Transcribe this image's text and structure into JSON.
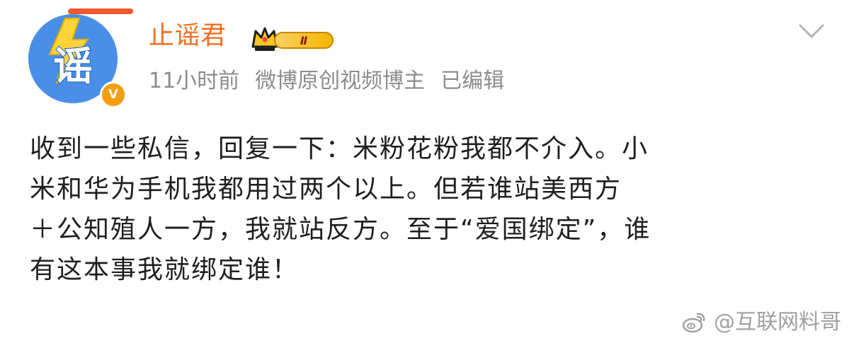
{
  "user": {
    "name": "止谣君",
    "level": "Ⅱ",
    "avatar_text": "谣",
    "verified_badge": "V"
  },
  "meta": {
    "time": "11小时前",
    "source": "微博原创视频博主",
    "edited": "已编辑"
  },
  "post": {
    "lines": [
      "收到一些私信，回复一下：米粉花粉我都不介入。小",
      "米和华为手机我都用过两个以上。但若谁站美西方",
      "＋公知殖人一方，我就站反方。至于“爱国绑定”，谁",
      "有这本事我就绑定谁！"
    ]
  },
  "watermark": {
    "text": "@互联网料哥"
  },
  "colors": {
    "username": "#f26f21",
    "meta": "#8c8c8c",
    "avatar": "#4a8fe7",
    "verified": "#f59e0b",
    "level_badge": "#f5b400",
    "watermark": "#a0a0a0"
  },
  "icons": {
    "avatar_bolt": "lightning-bolt-icon",
    "crown": "crown-icon",
    "more": "chevron-down-icon",
    "watermark": "weibo-logo-icon"
  }
}
